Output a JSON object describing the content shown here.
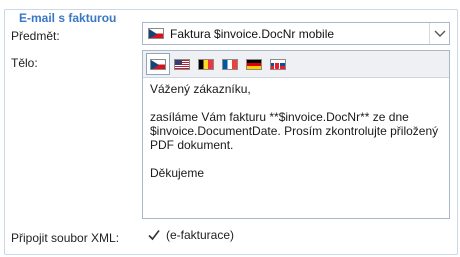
{
  "section": {
    "title": "E-mail s fakturou"
  },
  "subject": {
    "label": "Předmět:",
    "value": "Faktura $invoice.DocNr mobile",
    "flag": "flag-cz"
  },
  "body": {
    "label": "Tělo:",
    "languages": [
      {
        "code": "cz",
        "icon": "flag-cz-icon",
        "active": true
      },
      {
        "code": "us",
        "icon": "flag-us-icon",
        "active": false
      },
      {
        "code": "be",
        "icon": "flag-be-icon",
        "active": false
      },
      {
        "code": "fr",
        "icon": "flag-fr-icon",
        "active": false
      },
      {
        "code": "de",
        "icon": "flag-de-icon",
        "active": false
      },
      {
        "code": "sk",
        "icon": "flag-sk-icon",
        "active": false
      }
    ],
    "lines": [
      "Vážený zákazníku,",
      "",
      "zasíláme Vám fakturu **$invoice.DocNr** ze dne $invoice.DocumentDate. Prosím zkontrolujte přiložený PDF dokument.",
      "",
      "Děkujeme"
    ]
  },
  "attach_xml": {
    "label": "Připojit soubor XML:",
    "checked": true,
    "checkbox_label": "(e-fakturace)"
  },
  "colors": {
    "legend": "#3a78c3",
    "border": "#c9d8ea",
    "toolbar_bg": "#eef0f3"
  }
}
